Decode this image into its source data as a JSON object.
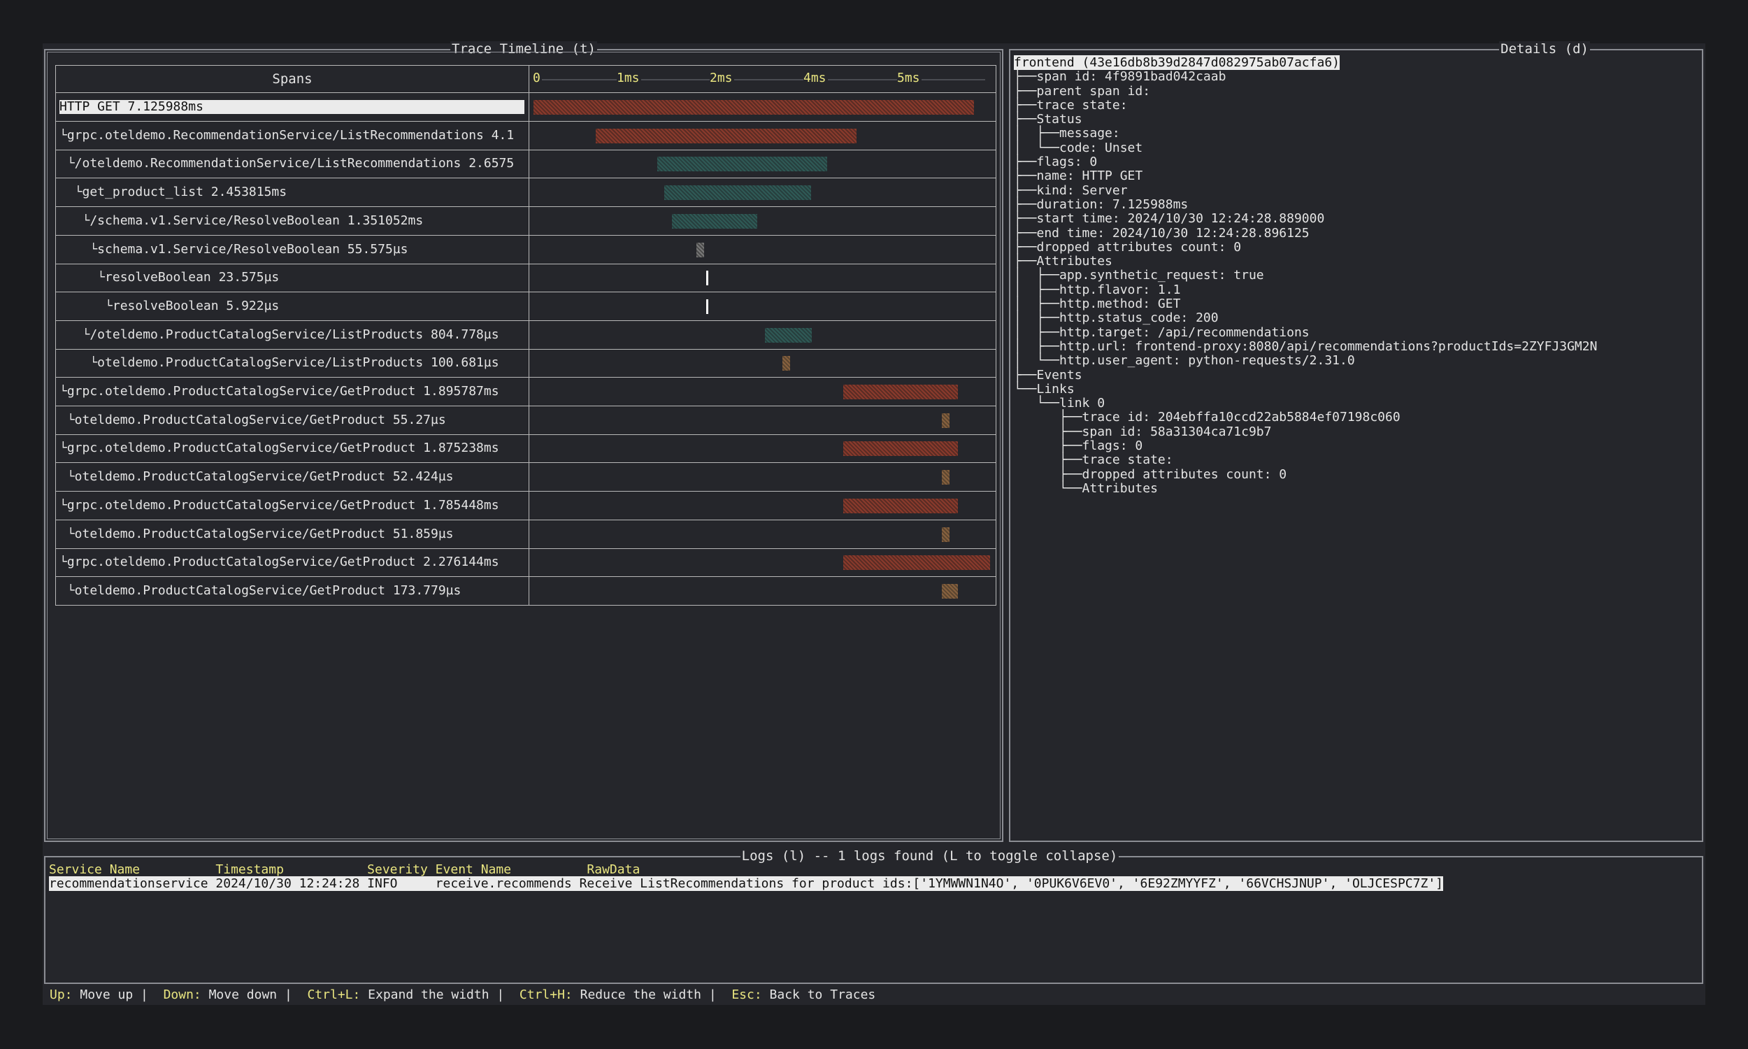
{
  "timeline": {
    "title": "Trace Timeline (t)",
    "spans_header": "Spans",
    "ticks": [
      {
        "label": "0",
        "ms": 0
      },
      {
        "label": "1ms",
        "ms": 1
      },
      {
        "label": "2ms",
        "ms": 2
      },
      {
        "label": "4ms",
        "ms": 4
      },
      {
        "label": "5ms",
        "ms": 5
      }
    ],
    "spans": [
      {
        "label": "HTTP GET 7.125988ms",
        "start": 0.0,
        "end": 0.96,
        "color": "red",
        "selected": true
      },
      {
        "label": "└grpc.oteldemo.RecommendationService/ListRecommendations 4.1",
        "start": 0.135,
        "end": 0.705,
        "color": "red"
      },
      {
        "label": " └/oteldemo.RecommendationService/ListRecommendations 2.6575",
        "start": 0.27,
        "end": 0.64,
        "color": "teal"
      },
      {
        "label": "  └get_product_list 2.453815ms",
        "start": 0.285,
        "end": 0.605,
        "color": "teal"
      },
      {
        "label": "   └/schema.v1.Service/ResolveBoolean 1.351052ms",
        "start": 0.302,
        "end": 0.488,
        "color": "teal"
      },
      {
        "label": "    └schema.v1.Service/ResolveBoolean 55.575µs",
        "start": 0.355,
        "end": 0.372,
        "color": "gray"
      },
      {
        "label": "     └resolveBoolean 23.575µs",
        "start": 0.376,
        "end": 0.38,
        "color": "white"
      },
      {
        "label": "      └resolveBoolean 5.922µs",
        "start": 0.376,
        "end": 0.38,
        "color": "white"
      },
      {
        "label": "   └/oteldemo.ProductCatalogService/ListProducts 804.778µs",
        "start": 0.505,
        "end": 0.607,
        "color": "teal"
      },
      {
        "label": "    └oteldemo.ProductCatalogService/ListProducts 100.681µs",
        "start": 0.543,
        "end": 0.56,
        "color": "brown"
      },
      {
        "label": "└grpc.oteldemo.ProductCatalogService/GetProduct 1.895787ms",
        "start": 0.675,
        "end": 0.925,
        "color": "red"
      },
      {
        "label": " └oteldemo.ProductCatalogService/GetProduct 55.27µs",
        "start": 0.89,
        "end": 0.907,
        "color": "brown"
      },
      {
        "label": "└grpc.oteldemo.ProductCatalogService/GetProduct 1.875238ms",
        "start": 0.675,
        "end": 0.925,
        "color": "red"
      },
      {
        "label": " └oteldemo.ProductCatalogService/GetProduct 52.424µs",
        "start": 0.89,
        "end": 0.907,
        "color": "brown"
      },
      {
        "label": "└grpc.oteldemo.ProductCatalogService/GetProduct 1.785448ms",
        "start": 0.675,
        "end": 0.925,
        "color": "red"
      },
      {
        "label": " └oteldemo.ProductCatalogService/GetProduct 51.859µs",
        "start": 0.89,
        "end": 0.907,
        "color": "brown"
      },
      {
        "label": "└grpc.oteldemo.ProductCatalogService/GetProduct 2.276144ms",
        "start": 0.675,
        "end": 0.995,
        "color": "red"
      },
      {
        "label": " └oteldemo.ProductCatalogService/GetProduct 173.779µs",
        "start": 0.89,
        "end": 0.925,
        "color": "brown"
      }
    ]
  },
  "details": {
    "title": "Details (d)",
    "lines": [
      "frontend (43e16db8b39d2847d082975ab07acfa6)",
      "├──span id: 4f9891bad042caab",
      "├──parent span id:",
      "├──trace state:",
      "├──Status",
      "│  ├──message:",
      "│  └──code: Unset",
      "├──flags: 0",
      "├──name: HTTP GET",
      "├──kind: Server",
      "├──duration: 7.125988ms",
      "├──start time: 2024/10/30 12:24:28.889000",
      "├──end time: 2024/10/30 12:24:28.896125",
      "├──dropped attributes count: 0",
      "├──Attributes",
      "│  ├──app.synthetic_request: true",
      "│  ├──http.flavor: 1.1",
      "│  ├──http.method: GET",
      "│  ├──http.status_code: 200",
      "│  ├──http.target: /api/recommendations",
      "│  ├──http.url: frontend-proxy:8080/api/recommendations?productIds=2ZYFJ3GM2N",
      "│  └──http.user_agent: python-requests/2.31.0",
      "├──Events",
      "└──Links",
      "   └──link 0",
      "      ├──trace id: 204ebffa10ccd22ab5884ef07198c060",
      "      ├──span id: 58a31304ca71c9b7",
      "      ├──flags: 0",
      "      ├──trace state:",
      "      ├──dropped attributes count: 0",
      "      └──Attributes"
    ]
  },
  "logs": {
    "title": "Logs (l) -- 1 logs found (L to toggle collapse)",
    "header": "Service Name          Timestamp           Severity Event Name          RawData",
    "rows": [
      "recommendationservice 2024/10/30 12:24:28 INFO     receive.recommends Receive ListRecommendations for product ids:['1YMWWN1N4O', '0PUK6V6EV0', '6E92ZMYYFZ', '66VCHSJNUP', 'OLJCESPC7Z']"
    ]
  },
  "footer": {
    "items": [
      {
        "key": "Up:",
        "label": " Move up |  "
      },
      {
        "key": "Down:",
        "label": " Move down |  "
      },
      {
        "key": "Ctrl+L:",
        "label": " Expand the width |  "
      },
      {
        "key": "Ctrl+H:",
        "label": " Reduce the width |  "
      },
      {
        "key": "Esc:",
        "label": " Back to Traces"
      }
    ]
  },
  "colors": {
    "red": "#8a3a2c",
    "teal": "#2f5a56",
    "brown": "#87613f",
    "gray": "#787878",
    "white": "#ffffff",
    "accent": "#e9e580"
  }
}
